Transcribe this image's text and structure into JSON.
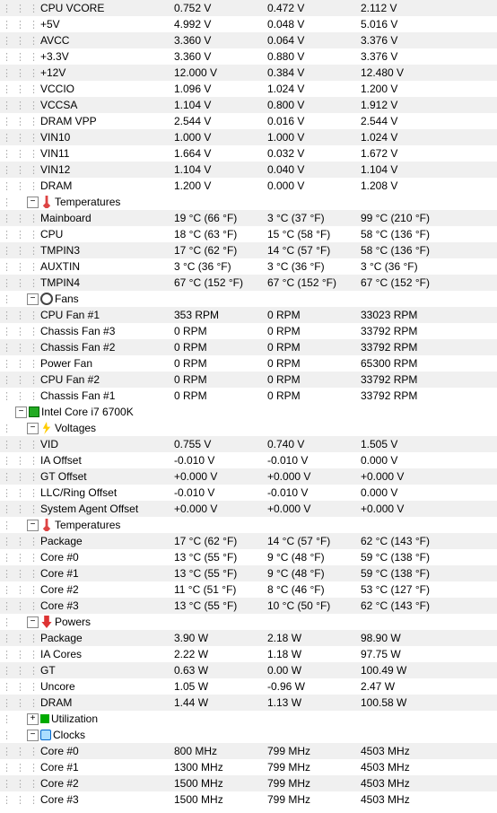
{
  "rows": [
    {
      "d": 3,
      "dots": 3,
      "n": "CPU VCORE",
      "c1": "0.752 V",
      "c2": "0.472 V",
      "c3": "2.112 V",
      "alt": 1
    },
    {
      "d": 3,
      "dots": 3,
      "n": "+5V",
      "c1": "4.992 V",
      "c2": "0.048 V",
      "c3": "5.016 V",
      "alt": 0
    },
    {
      "d": 3,
      "dots": 3,
      "n": "AVCC",
      "c1": "3.360 V",
      "c2": "0.064 V",
      "c3": "3.376 V",
      "alt": 1
    },
    {
      "d": 3,
      "dots": 3,
      "n": "+3.3V",
      "c1": "3.360 V",
      "c2": "0.880 V",
      "c3": "3.376 V",
      "alt": 0
    },
    {
      "d": 3,
      "dots": 3,
      "n": "+12V",
      "c1": "12.000 V",
      "c2": "0.384 V",
      "c3": "12.480 V",
      "alt": 1
    },
    {
      "d": 3,
      "dots": 3,
      "n": "VCCIO",
      "c1": "1.096 V",
      "c2": "1.024 V",
      "c3": "1.200 V",
      "alt": 0
    },
    {
      "d": 3,
      "dots": 3,
      "n": "VCCSA",
      "c1": "1.104 V",
      "c2": "0.800 V",
      "c3": "1.912 V",
      "alt": 1
    },
    {
      "d": 3,
      "dots": 3,
      "n": "DRAM VPP",
      "c1": "2.544 V",
      "c2": "0.016 V",
      "c3": "2.544 V",
      "alt": 0
    },
    {
      "d": 3,
      "dots": 3,
      "n": "VIN10",
      "c1": "1.000 V",
      "c2": "1.000 V",
      "c3": "1.024 V",
      "alt": 1
    },
    {
      "d": 3,
      "dots": 3,
      "n": "VIN11",
      "c1": "1.664 V",
      "c2": "0.032 V",
      "c3": "1.672 V",
      "alt": 0
    },
    {
      "d": 3,
      "dots": 3,
      "n": "VIN12",
      "c1": "1.104 V",
      "c2": "0.040 V",
      "c3": "1.104 V",
      "alt": 1
    },
    {
      "d": 3,
      "dots": 3,
      "n": "DRAM",
      "c1": "1.200 V",
      "c2": "0.000 V",
      "c3": "1.208 V",
      "alt": 0
    },
    {
      "d": 2,
      "dots": 1,
      "pm": "-",
      "ic": "temp",
      "n": "Temperatures",
      "alt": 0
    },
    {
      "d": 3,
      "dots": 3,
      "n": "Mainboard",
      "c1": "19 °C  (66 °F)",
      "c2": "3 °C  (37 °F)",
      "c3": "99 °C  (210 °F)",
      "alt": 1
    },
    {
      "d": 3,
      "dots": 3,
      "n": "CPU",
      "c1": "18 °C  (63 °F)",
      "c2": "15 °C  (58 °F)",
      "c3": "58 °C  (136 °F)",
      "alt": 0
    },
    {
      "d": 3,
      "dots": 3,
      "n": "TMPIN3",
      "c1": "17 °C  (62 °F)",
      "c2": "14 °C  (57 °F)",
      "c3": "58 °C  (136 °F)",
      "alt": 1
    },
    {
      "d": 3,
      "dots": 3,
      "n": "AUXTIN",
      "c1": "3 °C  (36 °F)",
      "c2": "3 °C  (36 °F)",
      "c3": "3 °C  (36 °F)",
      "alt": 0
    },
    {
      "d": 3,
      "dots": 3,
      "n": "TMPIN4",
      "c1": "67 °C  (152 °F)",
      "c2": "67 °C  (152 °F)",
      "c3": "67 °C  (152 °F)",
      "alt": 1
    },
    {
      "d": 2,
      "dots": 1,
      "pm": "-",
      "ic": "fan",
      "n": "Fans",
      "alt": 0
    },
    {
      "d": 3,
      "dots": 3,
      "n": "CPU Fan #1",
      "c1": "353 RPM",
      "c2": "0 RPM",
      "c3": "33023 RPM",
      "alt": 1
    },
    {
      "d": 3,
      "dots": 3,
      "n": "Chassis Fan #3",
      "c1": "0 RPM",
      "c2": "0 RPM",
      "c3": "33792 RPM",
      "alt": 0
    },
    {
      "d": 3,
      "dots": 3,
      "n": "Chassis Fan #2",
      "c1": "0 RPM",
      "c2": "0 RPM",
      "c3": "33792 RPM",
      "alt": 1
    },
    {
      "d": 3,
      "dots": 3,
      "n": "Power Fan",
      "c1": "0 RPM",
      "c2": "0 RPM",
      "c3": "65300 RPM",
      "alt": 0
    },
    {
      "d": 3,
      "dots": 3,
      "n": "CPU Fan #2",
      "c1": "0 RPM",
      "c2": "0 RPM",
      "c3": "33792 RPM",
      "alt": 1
    },
    {
      "d": 3,
      "dots": 3,
      "n": "Chassis Fan #1",
      "c1": "0 RPM",
      "c2": "0 RPM",
      "c3": "33792 RPM",
      "alt": 0
    },
    {
      "d": 1,
      "dots": 0,
      "pm": "-",
      "ic": "chip",
      "n": "Intel Core i7 6700K",
      "alt": 0
    },
    {
      "d": 2,
      "dots": 1,
      "pm": "-",
      "ic": "volt",
      "n": "Voltages",
      "alt": 0
    },
    {
      "d": 3,
      "dots": 3,
      "n": "VID",
      "c1": "0.755 V",
      "c2": "0.740 V",
      "c3": "1.505 V",
      "alt": 1
    },
    {
      "d": 3,
      "dots": 3,
      "n": "IA Offset",
      "c1": "-0.010 V",
      "c2": "-0.010 V",
      "c3": "0.000 V",
      "alt": 0
    },
    {
      "d": 3,
      "dots": 3,
      "n": "GT Offset",
      "c1": "+0.000 V",
      "c2": "+0.000 V",
      "c3": "+0.000 V",
      "alt": 1
    },
    {
      "d": 3,
      "dots": 3,
      "n": "LLC/Ring Offset",
      "c1": "-0.010 V",
      "c2": "-0.010 V",
      "c3": "0.000 V",
      "alt": 0
    },
    {
      "d": 3,
      "dots": 3,
      "n": "System Agent Offset",
      "c1": "+0.000 V",
      "c2": "+0.000 V",
      "c3": "+0.000 V",
      "alt": 1
    },
    {
      "d": 2,
      "dots": 1,
      "pm": "-",
      "ic": "temp",
      "n": "Temperatures",
      "alt": 0
    },
    {
      "d": 3,
      "dots": 3,
      "n": "Package",
      "c1": "17 °C  (62 °F)",
      "c2": "14 °C  (57 °F)",
      "c3": "62 °C  (143 °F)",
      "alt": 1
    },
    {
      "d": 3,
      "dots": 3,
      "n": "Core #0",
      "c1": "13 °C  (55 °F)",
      "c2": "9 °C  (48 °F)",
      "c3": "59 °C  (138 °F)",
      "alt": 0
    },
    {
      "d": 3,
      "dots": 3,
      "n": "Core #1",
      "c1": "13 °C  (55 °F)",
      "c2": "9 °C  (48 °F)",
      "c3": "59 °C  (138 °F)",
      "alt": 1
    },
    {
      "d": 3,
      "dots": 3,
      "n": "Core #2",
      "c1": "11 °C  (51 °F)",
      "c2": "8 °C  (46 °F)",
      "c3": "53 °C  (127 °F)",
      "alt": 0
    },
    {
      "d": 3,
      "dots": 3,
      "n": "Core #3",
      "c1": "13 °C  (55 °F)",
      "c2": "10 °C  (50 °F)",
      "c3": "62 °C  (143 °F)",
      "alt": 1
    },
    {
      "d": 2,
      "dots": 1,
      "pm": "-",
      "ic": "power",
      "n": "Powers",
      "alt": 0
    },
    {
      "d": 3,
      "dots": 3,
      "n": "Package",
      "c1": "3.90 W",
      "c2": "2.18 W",
      "c3": "98.90 W",
      "alt": 1
    },
    {
      "d": 3,
      "dots": 3,
      "n": "IA Cores",
      "c1": "2.22 W",
      "c2": "1.18 W",
      "c3": "97.75 W",
      "alt": 0
    },
    {
      "d": 3,
      "dots": 3,
      "n": "GT",
      "c1": "0.63 W",
      "c2": "0.00 W",
      "c3": "100.49 W",
      "alt": 1
    },
    {
      "d": 3,
      "dots": 3,
      "n": "Uncore",
      "c1": "1.05 W",
      "c2": "-0.96 W",
      "c3": "2.47 W",
      "alt": 0
    },
    {
      "d": 3,
      "dots": 3,
      "n": "DRAM",
      "c1": "1.44 W",
      "c2": "1.13 W",
      "c3": "100.58 W",
      "alt": 1
    },
    {
      "d": 2,
      "dots": 1,
      "pm": "+",
      "ic": "util",
      "n": "Utilization",
      "alt": 0
    },
    {
      "d": 2,
      "dots": 1,
      "pm": "-",
      "ic": "clock",
      "n": "Clocks",
      "alt": 0
    },
    {
      "d": 3,
      "dots": 3,
      "n": "Core #0",
      "c1": "800 MHz",
      "c2": "799 MHz",
      "c3": "4503 MHz",
      "alt": 1
    },
    {
      "d": 3,
      "dots": 3,
      "n": "Core #1",
      "c1": "1300 MHz",
      "c2": "799 MHz",
      "c3": "4503 MHz",
      "alt": 0
    },
    {
      "d": 3,
      "dots": 3,
      "n": "Core #2",
      "c1": "1500 MHz",
      "c2": "799 MHz",
      "c3": "4503 MHz",
      "alt": 1
    },
    {
      "d": 3,
      "dots": 3,
      "n": "Core #3",
      "c1": "1500 MHz",
      "c2": "799 MHz",
      "c3": "4503 MHz",
      "alt": 0
    }
  ],
  "indent_unit": 15,
  "pad_left": 2
}
